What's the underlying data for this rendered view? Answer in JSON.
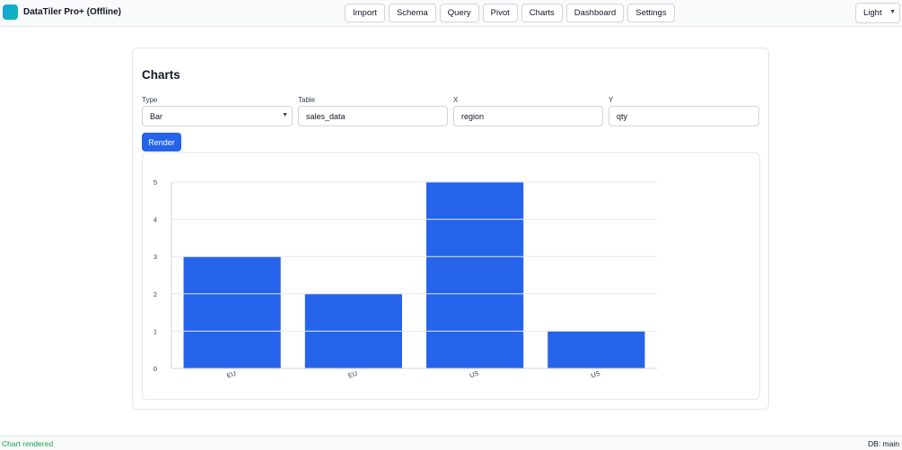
{
  "app": {
    "title": "DataTiler Pro+ (Offline)",
    "brand_gradient": [
      "#0ea5e9",
      "#14b8a6"
    ]
  },
  "nav": {
    "items": [
      "Import",
      "Schema",
      "Query",
      "Pivot",
      "Charts",
      "Dashboard",
      "Settings"
    ]
  },
  "theme": {
    "selected": "Light"
  },
  "charts_panel": {
    "title": "Charts",
    "type": {
      "label": "Type",
      "value": "Bar"
    },
    "table": {
      "label": "Table",
      "value": "sales_data"
    },
    "x": {
      "label": "X",
      "value": "region"
    },
    "y": {
      "label": "Y",
      "value": "qty"
    },
    "render_label": "Render"
  },
  "chart_data": {
    "type": "bar",
    "categories": [
      "EU",
      "EU",
      "US",
      "US"
    ],
    "values": [
      3,
      2,
      5,
      1
    ],
    "ylim": [
      0,
      5
    ],
    "yticks": [
      0,
      1,
      2,
      3,
      4,
      5
    ],
    "grid": true,
    "bar_color": "#2563eb",
    "title": "",
    "xlabel": "",
    "ylabel": ""
  },
  "status": {
    "message": "Chart rendered",
    "message_color": "#16a34a",
    "db": "DB: main"
  },
  "colors": {
    "accent": "#2563eb"
  }
}
